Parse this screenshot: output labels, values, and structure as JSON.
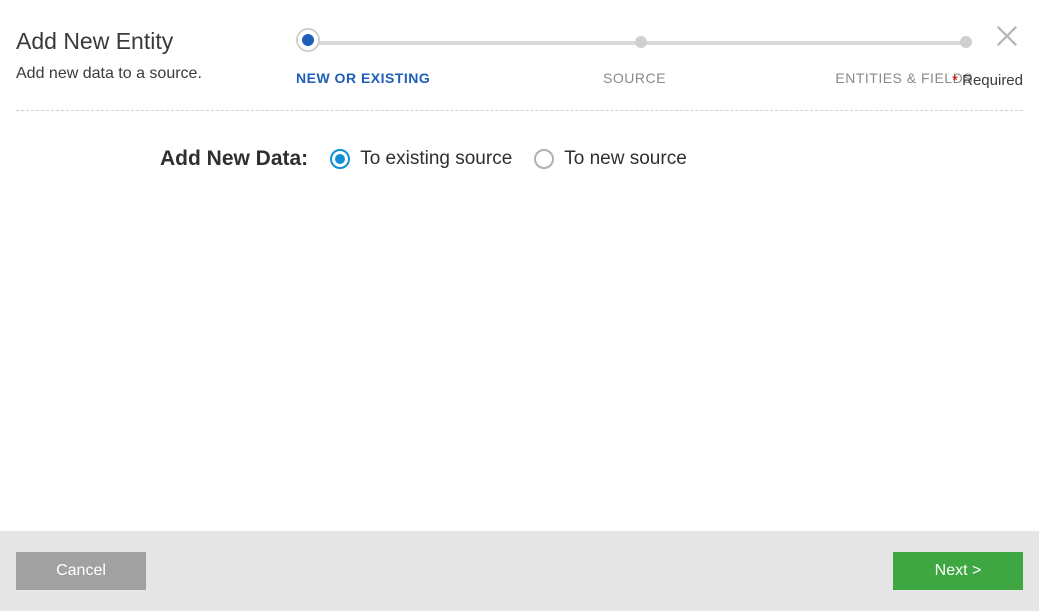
{
  "header": {
    "title": "Add New Entity",
    "subtitle": "Add new data to a source.",
    "required_label": "Required"
  },
  "stepper": {
    "steps": [
      {
        "label": "NEW OR EXISTING",
        "active": true
      },
      {
        "label": "SOURCE",
        "active": false
      },
      {
        "label": "ENTITIES & FIELDS",
        "active": false
      }
    ]
  },
  "content": {
    "prompt": "Add New Data:",
    "options": [
      {
        "label": "To existing source",
        "selected": true
      },
      {
        "label": "To new source",
        "selected": false
      }
    ]
  },
  "footer": {
    "cancel_label": "Cancel",
    "next_label": "Next >"
  }
}
